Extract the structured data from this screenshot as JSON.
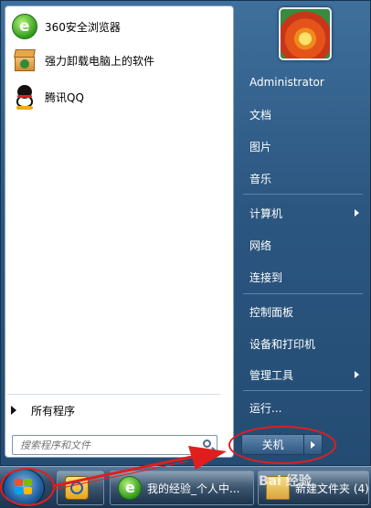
{
  "left_panel": {
    "pinned": [
      {
        "label": "360安全浏览器",
        "icon": "browser-360-icon"
      },
      {
        "label": "强力卸载电脑上的软件",
        "icon": "uninstaller-box-icon"
      },
      {
        "label": "腾讯QQ",
        "icon": "qq-penguin-icon"
      }
    ],
    "all_programs": "所有程序",
    "search_placeholder": "搜索程序和文件"
  },
  "user": {
    "name": "Administrator",
    "avatar": "flower-avatar"
  },
  "right_panel": {
    "items": [
      {
        "label": "文档",
        "has_submenu": false
      },
      {
        "label": "图片",
        "has_submenu": false
      },
      {
        "label": "音乐",
        "has_submenu": false
      },
      {
        "label": "计算机",
        "has_submenu": true
      },
      {
        "label": "网络",
        "has_submenu": false
      },
      {
        "label": "连接到",
        "has_submenu": false
      },
      {
        "label": "控制面板",
        "has_submenu": false
      },
      {
        "label": "设备和打印机",
        "has_submenu": false
      },
      {
        "label": "管理工具",
        "has_submenu": true
      },
      {
        "label": "运行...",
        "has_submenu": false
      }
    ],
    "shutdown_label": "关机"
  },
  "taskbar": {
    "buttons": [
      {
        "label": "",
        "icon": "outlook-icon"
      },
      {
        "label": "我的经验_个人中...",
        "icon": "browser-360-icon"
      },
      {
        "label": "新建文件夹 (4)",
        "icon": "folder-icon"
      }
    ],
    "watermark": "Bai 经验"
  },
  "annotation_color": "#e01e1e"
}
